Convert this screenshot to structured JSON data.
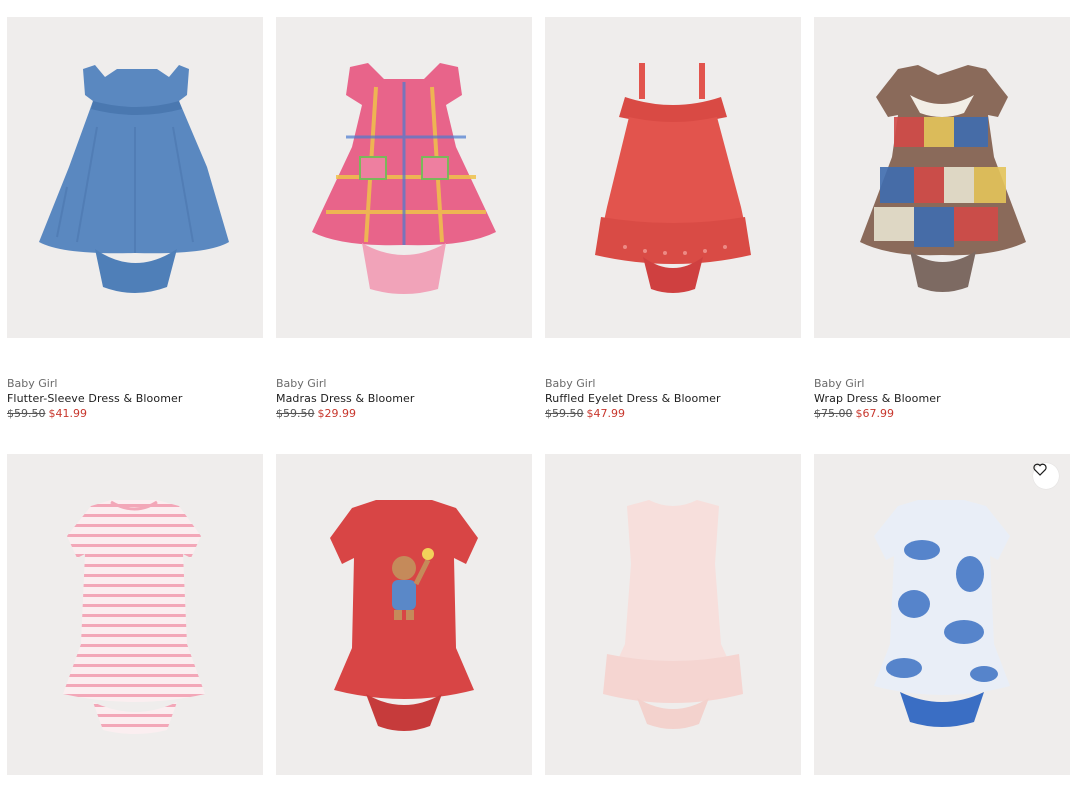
{
  "products": [
    {
      "category": "Baby Girl",
      "name": "Flutter-Sleeve Dress & Bloomer",
      "original_price": "$59.50",
      "sale_price": "$41.99",
      "image": "chambray-dress-icon",
      "color": "#5a88c0"
    },
    {
      "category": "Baby Girl",
      "name": "Madras Dress & Bloomer",
      "original_price": "$59.50",
      "sale_price": "$29.99",
      "image": "plaid-dress-icon",
      "color": "#e8648a"
    },
    {
      "category": "Baby Girl",
      "name": "Ruffled Eyelet Dress & Bloomer",
      "original_price": "$59.50",
      "sale_price": "$47.99",
      "image": "eyelet-dress-icon",
      "color": "#e2544d"
    },
    {
      "category": "Baby Girl",
      "name": "Wrap Dress & Bloomer",
      "original_price": "$75.00",
      "sale_price": "$67.99",
      "image": "patchwork-dress-icon",
      "color": "#8a6a5a"
    }
  ],
  "products_row2": [
    {
      "image": "striped-dress-icon",
      "color": "#f3a7b8"
    },
    {
      "image": "bear-dress-icon",
      "color": "#d84545"
    },
    {
      "image": "pink-dress-icon",
      "color": "#f7dfdc"
    },
    {
      "image": "tie-dye-dress-icon",
      "color": "#3d72c4"
    }
  ],
  "wishlist_icon": "heart-icon"
}
